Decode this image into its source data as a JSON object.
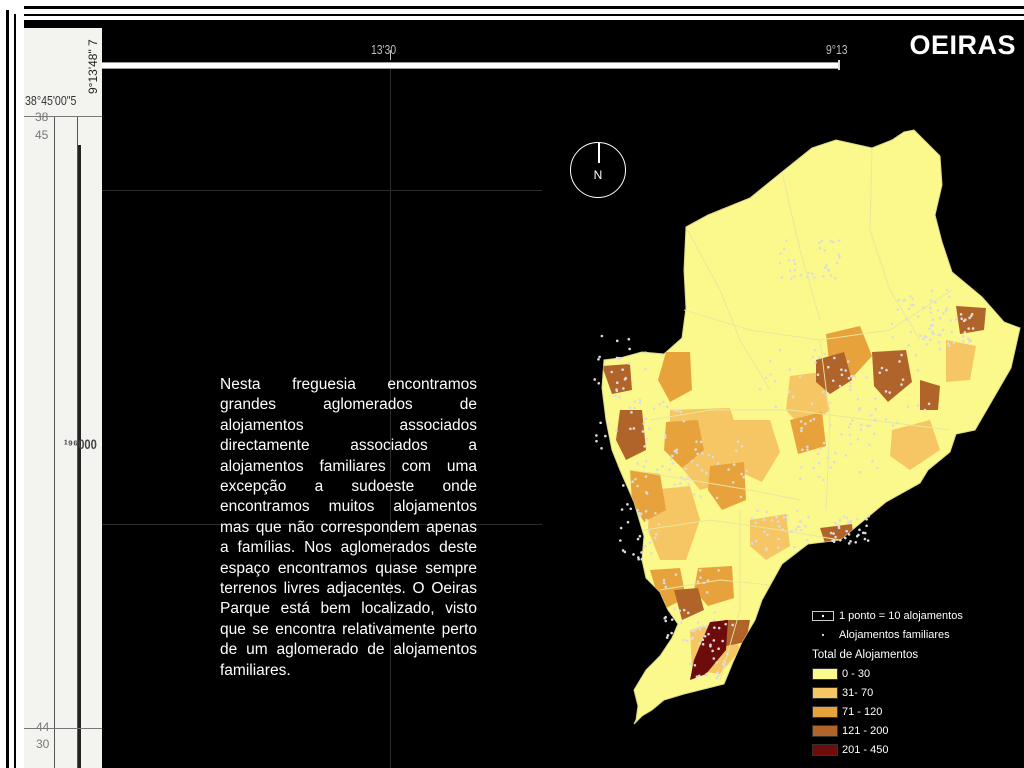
{
  "title": "OEIRAS",
  "compass": {
    "letter": "N",
    "icon": "north-arrow-icon"
  },
  "graticule": {
    "top_labels": [
      "13'30",
      "9°13"
    ],
    "left_vertical_label": "9°13'48\" 7",
    "left_labels": [
      "38°45'00\"5",
      "38",
      "45",
      "¹⁹⁶000",
      "44",
      "30"
    ]
  },
  "description": "Nesta freguesia encontramos grandes aglomerados de alojamentos associados directamente associados a alojamentos familiares com uma excepção a sudoeste onde encontramos muitos alojamentos mas que não correspondem apenas a famílias. Nos aglomerados deste espaço encontramos quase sempre terrenos livres adjacentes. O Oeiras Parque está bem localizado, visto que se encontra relativamente perto de um aglomerado de alojamentos familiares.",
  "legend": {
    "point_label": "1 ponto = 10 alojamentos",
    "dot_label": "Alojamentos familiares",
    "classes_title": "Total de Alojamentos",
    "classes": [
      {
        "label": "0 - 30",
        "color": "#fbf98b"
      },
      {
        "label": "31- 70",
        "color": "#f5c663"
      },
      {
        "label": "71 - 120",
        "color": "#e8a23c"
      },
      {
        "label": "121 - 200",
        "color": "#b0642a"
      },
      {
        "label": "201 - 450",
        "color": "#6e0c0c"
      }
    ]
  },
  "colors": {
    "background": "#000000",
    "map_base": "#fbf98b",
    "dots": "#dcdcdc"
  }
}
